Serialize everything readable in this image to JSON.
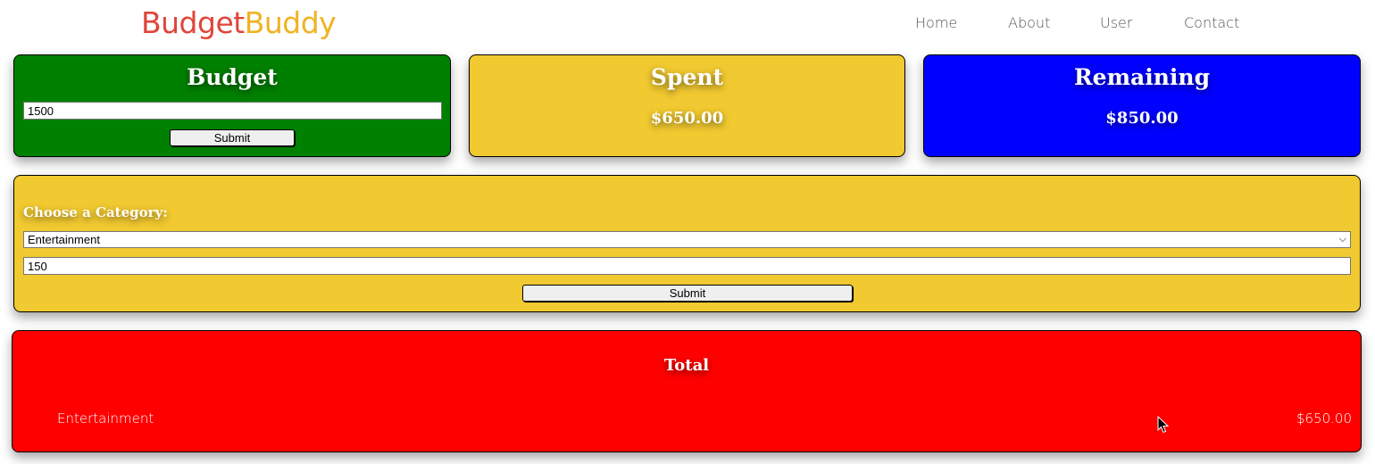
{
  "brand": {
    "part1": "Budget",
    "part2": "Buddy",
    "color1": "#e0453a",
    "color2": "#f0b323"
  },
  "nav": {
    "items": [
      "Home",
      "About",
      "User",
      "Contact"
    ]
  },
  "budget_card": {
    "title": "Budget",
    "input_value": "1500",
    "submit_label": "Submit",
    "color": "#008000"
  },
  "spent_card": {
    "title": "Spent",
    "amount": "$650.00",
    "color": "#f1c930"
  },
  "remaining_card": {
    "title": "Remaining",
    "amount": "$850.00",
    "color": "#0000ff"
  },
  "category_form": {
    "label": "Choose a Category:",
    "selected_category": "Entertainment",
    "amount_value": "150",
    "submit_label": "Submit",
    "color": "#f1c930"
  },
  "total_card": {
    "title": "Total",
    "color": "#ff0000",
    "rows": [
      {
        "category": "Entertainment",
        "amount": "$650.00"
      }
    ]
  }
}
